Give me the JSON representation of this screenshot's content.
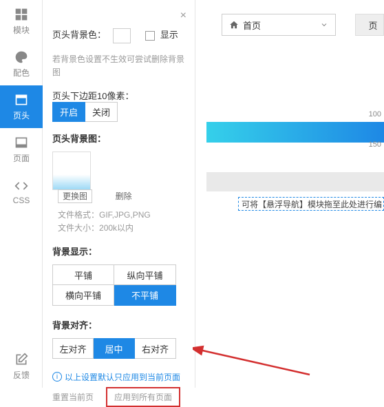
{
  "sidebar": [
    {
      "label": "模块",
      "name": "sidebar-item-module"
    },
    {
      "label": "配色",
      "name": "sidebar-item-color"
    },
    {
      "label": "页头",
      "name": "sidebar-item-header"
    },
    {
      "label": "页面",
      "name": "sidebar-item-page"
    },
    {
      "label": "CSS",
      "name": "sidebar-item-css"
    },
    {
      "label": "反馈",
      "name": "sidebar-item-feedback"
    }
  ],
  "panel": {
    "bgcolor_label": "页头背景色：",
    "show_label": "显示",
    "bgcolor_hint": "若背景色设置不生效可尝试删除背景图",
    "margin_label": "页头下边距10像素：",
    "toggle_on": "开启",
    "toggle_off": "关闭",
    "bgimg_section": "页头背景图：",
    "replace_img": "更换图",
    "delete_img": "删除",
    "file_format_label": "文件格式：",
    "file_format_value": "GIF,JPG,PNG",
    "file_size_label": "文件大小：",
    "file_size_value": "200k以内",
    "bg_display_section": "背景显示：",
    "tile": "平铺",
    "tile_v": "纵向平铺",
    "tile_h": "横向平铺",
    "no_tile": "不平铺",
    "bg_align_section": "背景对齐：",
    "align_left": "左对齐",
    "align_center": "居中",
    "align_right": "右对齐",
    "info_note": "以上设置默认只应用到当前页面",
    "reset_link": "重置当前页",
    "apply_all": "应用到所有页面"
  },
  "preview": {
    "dropdown_label": "首页",
    "side_btn_label": "页",
    "ruler_100": "100",
    "ruler_150": "150",
    "drop_zone": "可将【悬浮导航】模块拖至此处进行编"
  }
}
